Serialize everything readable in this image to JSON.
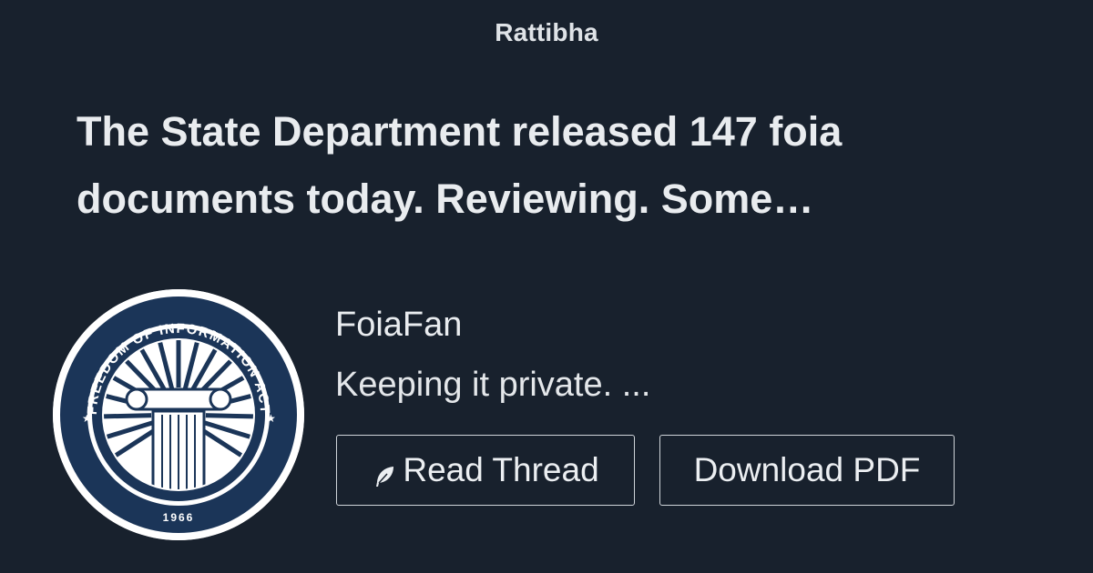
{
  "site": {
    "name": "Rattibha"
  },
  "thread": {
    "headline": "The State Department released 147 foia documents today. Reviewing. Some…"
  },
  "author": {
    "name": "FoiaFan",
    "bio": "Keeping it private. ...",
    "avatar": {
      "seal_text_top": "FREEDOM OF INFORMATION ACT",
      "seal_year": "1966",
      "seal_color": "#1b3558"
    }
  },
  "actions": {
    "read_thread_label": "Read Thread",
    "download_pdf_label": "Download PDF",
    "read_icon": "feather-icon"
  },
  "colors": {
    "background": "#18212d",
    "text": "#e9ecef",
    "button_border": "#cfd4d9"
  }
}
